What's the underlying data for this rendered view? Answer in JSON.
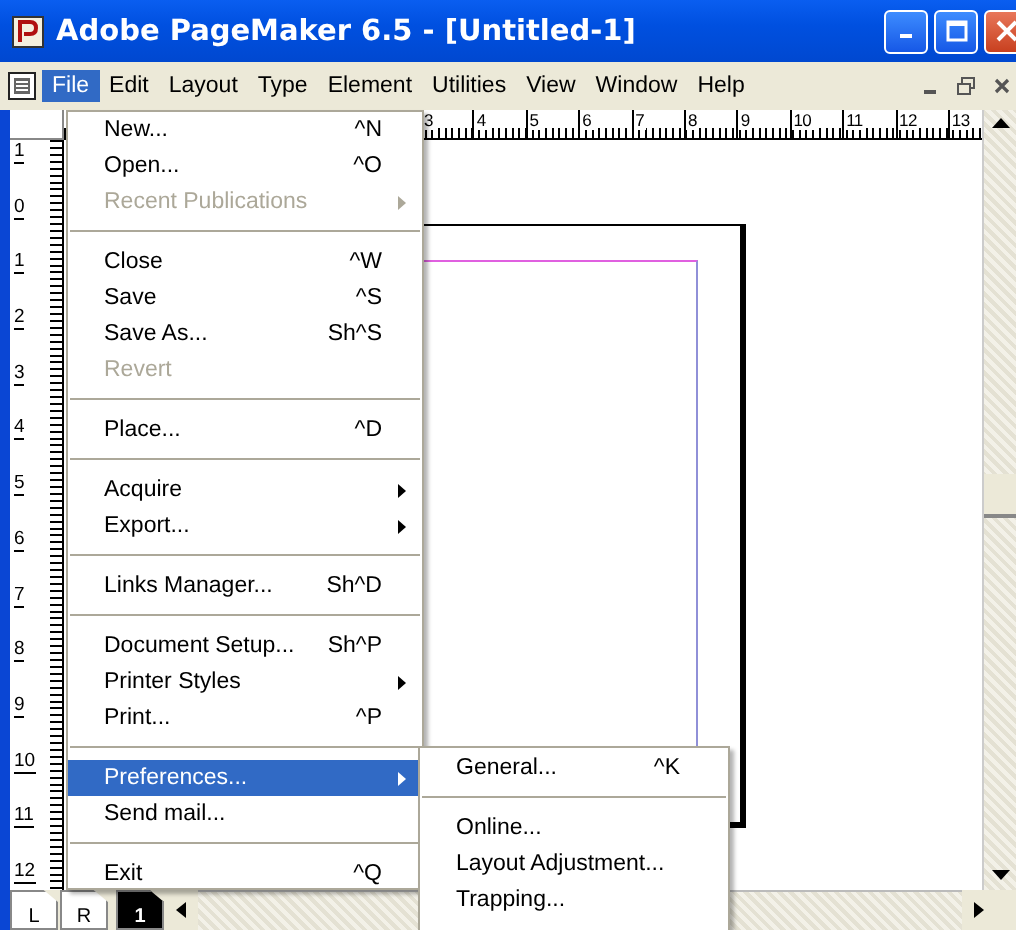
{
  "window": {
    "title": "Adobe PageMaker 6.5 - [Untitled-1]"
  },
  "menubar": [
    {
      "label": "File",
      "selected": true
    },
    {
      "label": "Edit",
      "selected": false
    },
    {
      "label": "Layout",
      "selected": false
    },
    {
      "label": "Type",
      "selected": false
    },
    {
      "label": "Element",
      "selected": false
    },
    {
      "label": "Utilities",
      "selected": false
    },
    {
      "label": "View",
      "selected": false
    },
    {
      "label": "Window",
      "selected": false
    },
    {
      "label": "Help",
      "selected": false
    }
  ],
  "file_menu": [
    {
      "kind": "item",
      "label": "New...",
      "shortcut": "^N",
      "disabled": false,
      "submenu": false,
      "selected": false
    },
    {
      "kind": "item",
      "label": "Open...",
      "shortcut": "^O",
      "disabled": false,
      "submenu": false,
      "selected": false
    },
    {
      "kind": "item",
      "label": "Recent Publications",
      "disabled": true,
      "submenu": true,
      "selected": false
    },
    {
      "kind": "separator"
    },
    {
      "kind": "item",
      "label": "Close",
      "shortcut": "^W",
      "disabled": false,
      "submenu": false,
      "selected": false
    },
    {
      "kind": "item",
      "label": "Save",
      "shortcut": "^S",
      "disabled": false,
      "submenu": false,
      "selected": false
    },
    {
      "kind": "item",
      "label": "Save As...",
      "shortcut": "Sh^S",
      "disabled": false,
      "submenu": false,
      "selected": false
    },
    {
      "kind": "item",
      "label": "Revert",
      "disabled": true,
      "submenu": false,
      "selected": false
    },
    {
      "kind": "separator"
    },
    {
      "kind": "item",
      "label": "Place...",
      "shortcut": "^D",
      "disabled": false,
      "submenu": false,
      "selected": false
    },
    {
      "kind": "separator"
    },
    {
      "kind": "item",
      "label": "Acquire",
      "disabled": false,
      "submenu": true,
      "selected": false
    },
    {
      "kind": "item",
      "label": "Export...",
      "disabled": false,
      "submenu": true,
      "selected": false
    },
    {
      "kind": "separator"
    },
    {
      "kind": "item",
      "label": "Links Manager...",
      "shortcut": "Sh^D",
      "disabled": false,
      "submenu": false,
      "selected": false
    },
    {
      "kind": "separator"
    },
    {
      "kind": "item",
      "label": "Document Setup...",
      "shortcut": "Sh^P",
      "disabled": false,
      "submenu": false,
      "selected": false
    },
    {
      "kind": "item",
      "label": "Printer Styles",
      "disabled": false,
      "submenu": true,
      "selected": false
    },
    {
      "kind": "item",
      "label": "Print...",
      "shortcut": "^P",
      "disabled": false,
      "submenu": false,
      "selected": false
    },
    {
      "kind": "separator"
    },
    {
      "kind": "item",
      "label": "Preferences...",
      "disabled": false,
      "submenu": true,
      "selected": true
    },
    {
      "kind": "item",
      "label": "Send mail...",
      "disabled": false,
      "submenu": false,
      "selected": false
    },
    {
      "kind": "separator"
    },
    {
      "kind": "item",
      "label": "Exit",
      "shortcut": "^Q",
      "disabled": false,
      "submenu": false,
      "selected": false
    }
  ],
  "preferences_submenu": [
    {
      "kind": "item",
      "label": "General...",
      "shortcut": "^K"
    },
    {
      "kind": "separator"
    },
    {
      "kind": "item",
      "label": "Online..."
    },
    {
      "kind": "item",
      "label": "Layout Adjustment..."
    },
    {
      "kind": "item",
      "label": "Trapping..."
    }
  ],
  "rulers": {
    "top_labels": [
      "3",
      "4",
      "5",
      "6",
      "7",
      "8",
      "9",
      "10",
      "11",
      "12",
      "13"
    ],
    "side_labels": [
      "1",
      "0",
      "1",
      "2",
      "3",
      "4",
      "5",
      "6",
      "7",
      "8",
      "9",
      "10",
      "11",
      "12"
    ]
  },
  "page_icons": [
    {
      "label": "L",
      "kind": "master",
      "selected": false
    },
    {
      "label": "R",
      "kind": "master",
      "selected": false
    },
    {
      "label": "1",
      "kind": "page",
      "selected": true
    }
  ]
}
